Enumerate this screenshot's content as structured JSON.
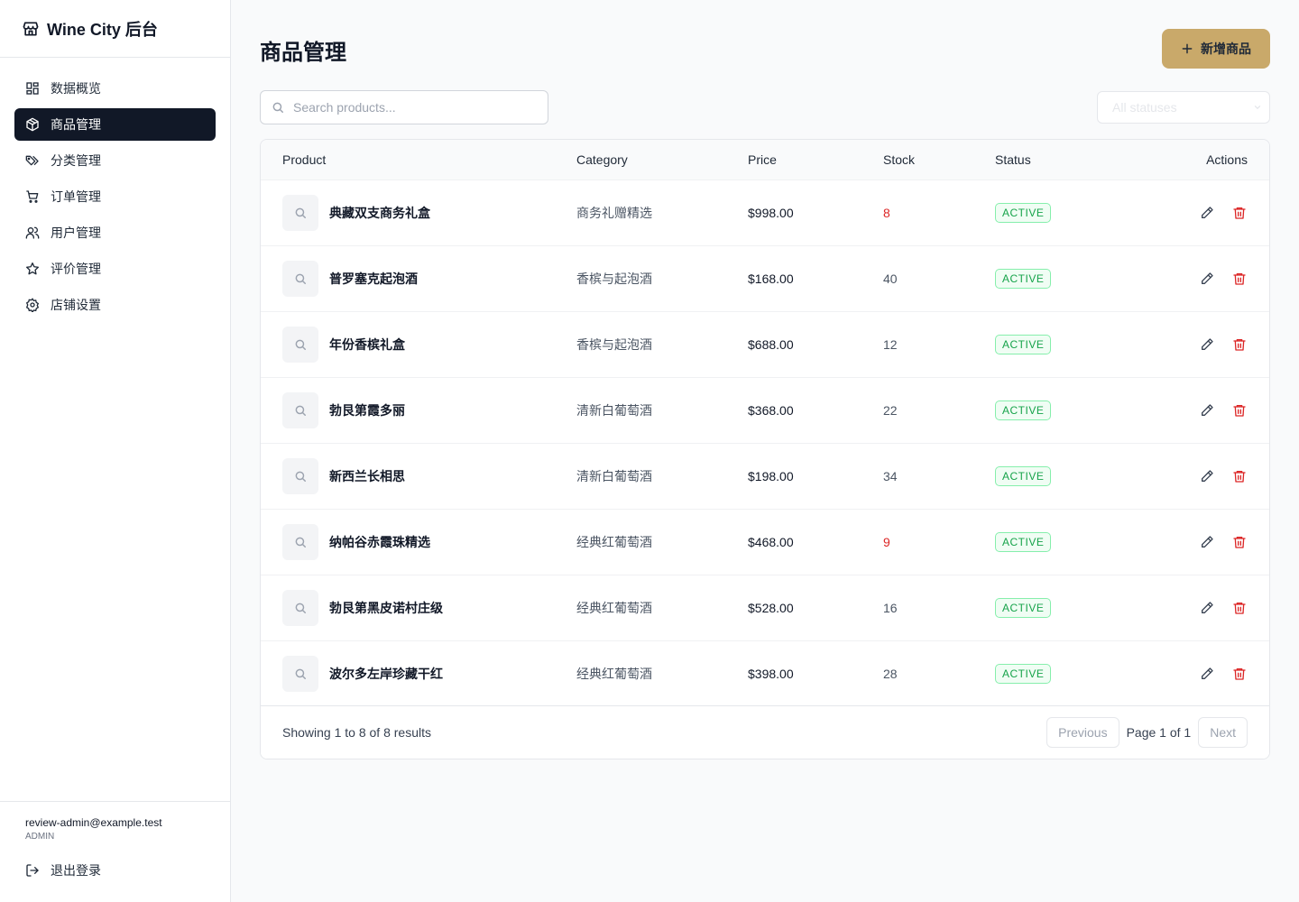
{
  "app": {
    "brand": "Wine City 后台"
  },
  "sidebar": {
    "items": [
      {
        "label": "数据概览",
        "icon": "dashboard-icon",
        "active": false
      },
      {
        "label": "商品管理",
        "icon": "package-icon",
        "active": true
      },
      {
        "label": "分类管理",
        "icon": "tags-icon",
        "active": false
      },
      {
        "label": "订单管理",
        "icon": "cart-icon",
        "active": false
      },
      {
        "label": "用户管理",
        "icon": "users-icon",
        "active": false
      },
      {
        "label": "评价管理",
        "icon": "star-icon",
        "active": false
      },
      {
        "label": "店铺设置",
        "icon": "settings-icon",
        "active": false
      }
    ],
    "user": {
      "email": "review-admin@example.test",
      "role": "ADMIN"
    },
    "logout_label": "退出登录"
  },
  "main": {
    "title": "商品管理",
    "add_button_label": "新增商品",
    "search_placeholder": "Search products...",
    "status_filter": "All statuses",
    "table": {
      "headers": {
        "product": "Product",
        "category": "Category",
        "price": "Price",
        "stock": "Stock",
        "status": "Status",
        "actions": "Actions"
      },
      "rows": [
        {
          "name": "典藏双支商务礼盒",
          "category": "商务礼赠精选",
          "price": "$998.00",
          "stock": "8",
          "low_stock": true,
          "status": "ACTIVE"
        },
        {
          "name": "普罗塞克起泡酒",
          "category": "香槟与起泡酒",
          "price": "$168.00",
          "stock": "40",
          "low_stock": false,
          "status": "ACTIVE"
        },
        {
          "name": "年份香槟礼盒",
          "category": "香槟与起泡酒",
          "price": "$688.00",
          "stock": "12",
          "low_stock": false,
          "status": "ACTIVE"
        },
        {
          "name": "勃艮第霞多丽",
          "category": "清新白葡萄酒",
          "price": "$368.00",
          "stock": "22",
          "low_stock": false,
          "status": "ACTIVE"
        },
        {
          "name": "新西兰长相思",
          "category": "清新白葡萄酒",
          "price": "$198.00",
          "stock": "34",
          "low_stock": false,
          "status": "ACTIVE"
        },
        {
          "name": "纳帕谷赤霞珠精选",
          "category": "经典红葡萄酒",
          "price": "$468.00",
          "stock": "9",
          "low_stock": true,
          "status": "ACTIVE"
        },
        {
          "name": "勃艮第黑皮诺村庄级",
          "category": "经典红葡萄酒",
          "price": "$528.00",
          "stock": "16",
          "low_stock": false,
          "status": "ACTIVE"
        },
        {
          "name": "波尔多左岸珍藏干红",
          "category": "经典红葡萄酒",
          "price": "$398.00",
          "stock": "28",
          "low_stock": false,
          "status": "ACTIVE"
        }
      ]
    },
    "pagination": {
      "showing": "Showing 1 to 8 of 8 results",
      "previous": "Previous",
      "page_info": "Page 1 of 1",
      "next": "Next"
    }
  },
  "colors": {
    "accent": "#c9a96a",
    "active_nav": "#111827",
    "danger": "#dc2626",
    "success": "#16a34a"
  }
}
